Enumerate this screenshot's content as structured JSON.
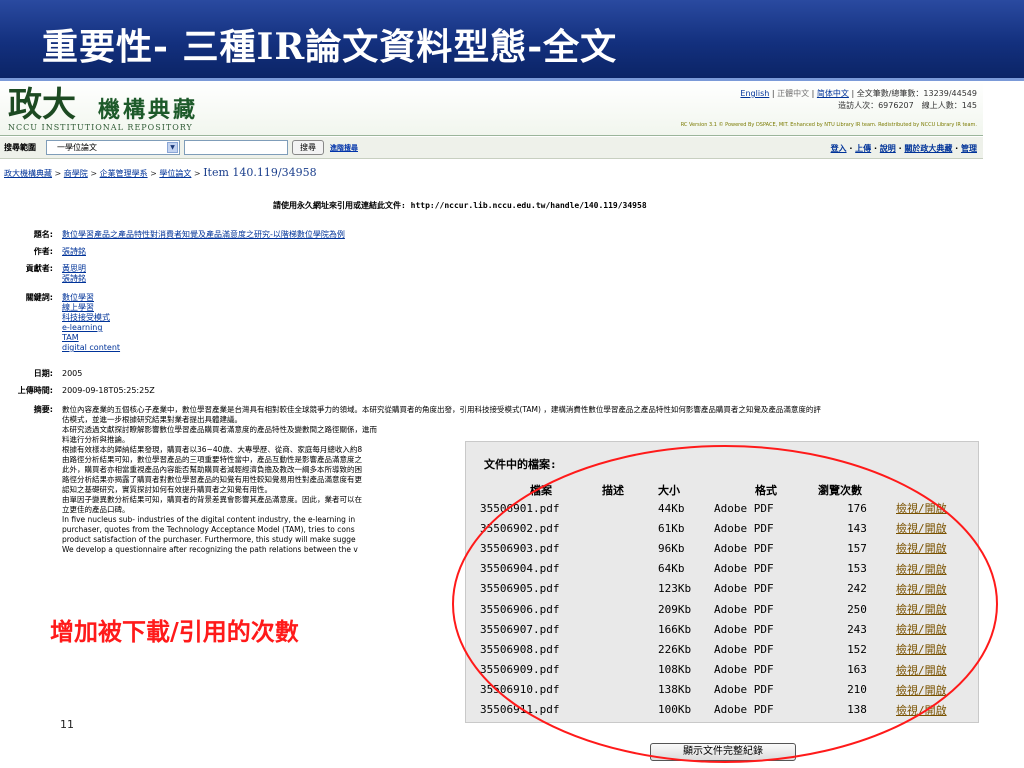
{
  "slide": {
    "title": "重要性- 三種IR論文資料型態-全文",
    "annotation": "增加被下載/引用的次數",
    "number": "11"
  },
  "header": {
    "logo_text": "政大",
    "logo_name": "機構典藏",
    "logo_sub": "NCCU INSTITUTIONAL REPOSITORY",
    "lang_english": "English",
    "lang_trad": "正體中文",
    "lang_simp": "简体中文",
    "counts": "全文筆數/總筆數：13239/44549",
    "visits": "造訪人次：6976207　線上人數：145",
    "powered": "RC Version 3.1 © Powered By DSPACE, MIT. Enhanced by NTU Library IR team. Redistributed by NCCU Library IR team."
  },
  "search": {
    "scope_label": "搜尋範圍",
    "scope_value": "一學位論文",
    "input_value": "",
    "button": "搜尋",
    "advanced": "進階搜尋",
    "links": [
      "登入",
      "上傳",
      "說明",
      "關於政大典藏",
      "管理"
    ]
  },
  "breadcrumb": {
    "items": [
      "政大機構典藏",
      "商學院",
      "企業管理學系",
      "學位論文"
    ],
    "current": "Item 140.119/34958"
  },
  "permalink": "請使用永久網址來引用或連結此文件: http://nccur.lib.nccu.edu.tw/handle/140.119/34958",
  "metadata": {
    "title_label": "題名:",
    "title_value": "數位學習產品之產品特性對消費者知覺及產品滿意度之研究-以階梯數位學院為例",
    "author_label": "作者:",
    "author_value": "張詩銘",
    "contributor_label": "貢獻者:",
    "contributors": [
      "黃思明",
      "張詩銘"
    ],
    "keywords_label": "關鍵詞:",
    "keywords": [
      "數位學習",
      "線上學習",
      "科技接受模式",
      "e-learning",
      "TAM",
      "digital content"
    ],
    "date_label": "日期:",
    "date_value": "2005",
    "uploaded_label": "上傳時間:",
    "uploaded_value": "2009-09-18T05:25:25Z",
    "abstract_label": "摘要:",
    "abstract_lines": [
      "數位內容產業的五個核心子產業中，數位學習產業是台灣具有相對較佳全球競爭力的領域。本研究從購買者的角度出發，引用科技接受模式(TAM) ，建構消費性數位學習產品之產品特性如何影響產品購買者之知覺及產品滿意度的評",
      "估模式，並進一步根據研究結果對業者提出具體建議。",
      "本研究透過文獻探討瞭解影響數位學習產品購買者滿意度的產品特性及變數間之路徑關係，進而",
      "料進行分析與推論。",
      "根據有效樣本的歸納結果發現，購買者以36~40歲、大專學歷、從商、家庭每月總收入約8",
      "由路徑分析結果可知，數位學習產品的三項重要特性當中，產品互動性是影響產品滿意度之",
      "此外，購買者亦相當重視產品內容能否幫助購買者減輕經濟負擔及教改一綱多本所導致的困",
      "路徑分析結果亦揭露了購買者對數位學習產品的知覺有用性較知覺易用性對產品滿意度有更",
      "認知之基礎研究，實質探討如何有效提升購買者之知覺有用性。",
      "由單因子變異數分析結果可知，購買者的背景差異會影響其產品滿意度。因此，業者可以在",
      "立更佳的產品口碑。",
      "In five nucleus sub- industries of the digital content industry, the e-learning in",
      "purchaser, quotes from the Technology Acceptance Model (TAM), tries to cons",
      "product satisfaction of the purchaser. Furthermore, this study will make sugge",
      "We develop a questionnaire after recognizing the path relations between the v"
    ]
  },
  "files": {
    "title": "文件中的檔案:",
    "headers": [
      "檔案",
      "描述",
      "大小",
      "格式",
      "瀏覽次數",
      ""
    ],
    "rows": [
      {
        "name": "35506901.pdf",
        "desc": "",
        "size": "44Kb",
        "format": "Adobe PDF",
        "views": "176",
        "action": "檢視/開啟"
      },
      {
        "name": "35506902.pdf",
        "desc": "",
        "size": "61Kb",
        "format": "Adobe PDF",
        "views": "143",
        "action": "檢視/開啟"
      },
      {
        "name": "35506903.pdf",
        "desc": "",
        "size": "96Kb",
        "format": "Adobe PDF",
        "views": "157",
        "action": "檢視/開啟"
      },
      {
        "name": "35506904.pdf",
        "desc": "",
        "size": "64Kb",
        "format": "Adobe PDF",
        "views": "153",
        "action": "檢視/開啟"
      },
      {
        "name": "35506905.pdf",
        "desc": "",
        "size": "123Kb",
        "format": "Adobe PDF",
        "views": "242",
        "action": "檢視/開啟"
      },
      {
        "name": "35506906.pdf",
        "desc": "",
        "size": "209Kb",
        "format": "Adobe PDF",
        "views": "250",
        "action": "檢視/開啟"
      },
      {
        "name": "35506907.pdf",
        "desc": "",
        "size": "166Kb",
        "format": "Adobe PDF",
        "views": "243",
        "action": "檢視/開啟"
      },
      {
        "name": "35506908.pdf",
        "desc": "",
        "size": "226Kb",
        "format": "Adobe PDF",
        "views": "152",
        "action": "檢視/開啟"
      },
      {
        "name": "35506909.pdf",
        "desc": "",
        "size": "108Kb",
        "format": "Adobe PDF",
        "views": "163",
        "action": "檢視/開啟"
      },
      {
        "name": "35506910.pdf",
        "desc": "",
        "size": "138Kb",
        "format": "Adobe PDF",
        "views": "210",
        "action": "檢視/開啟"
      },
      {
        "name": "35506911.pdf",
        "desc": "",
        "size": "100Kb",
        "format": "Adobe PDF",
        "views": "138",
        "action": "檢視/開啟"
      }
    ],
    "show_full": "顯示文件完整紀錄"
  },
  "colors": {
    "title_bar": "#13307e",
    "annotation": "#ff1a1a",
    "link": "#003399",
    "file_link": "#7a5200"
  }
}
